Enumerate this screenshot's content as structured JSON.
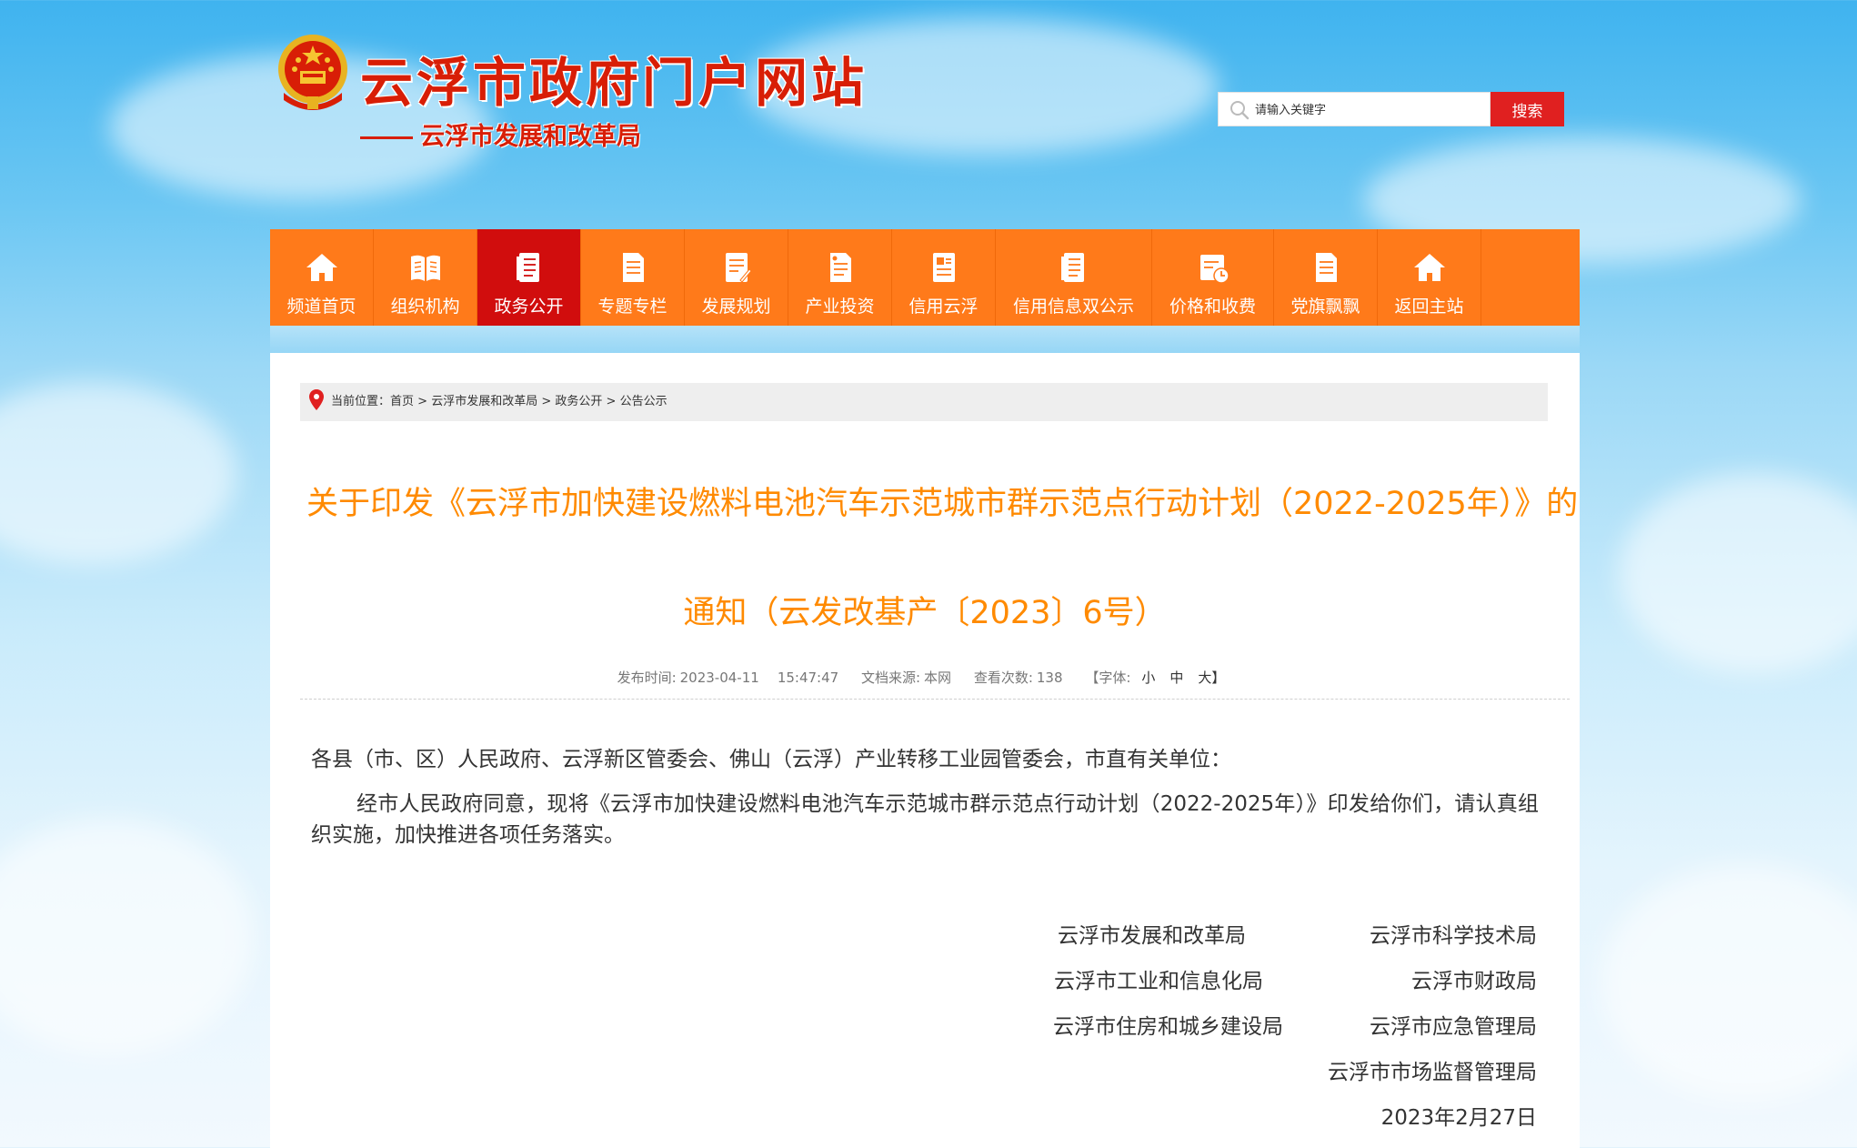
{
  "header": {
    "site_title": "云浮市政府门户网站",
    "sub_title": "云浮市发展和改革局",
    "search": {
      "placeholder": "请输入关键字",
      "button_label": "搜索"
    }
  },
  "nav": {
    "items": [
      {
        "label": "频道首页",
        "icon": "home-icon"
      },
      {
        "label": "组织机构",
        "icon": "book-icon"
      },
      {
        "label": "政务公开",
        "icon": "document-icon",
        "active": true
      },
      {
        "label": "专题专栏",
        "icon": "document-icon"
      },
      {
        "label": "发展规划",
        "icon": "document-edit-icon"
      },
      {
        "label": "产业投资",
        "icon": "document-icon"
      },
      {
        "label": "信用云浮",
        "icon": "document-icon"
      },
      {
        "label": "信用信息双公示",
        "icon": "document-icon"
      },
      {
        "label": "价格和收费",
        "icon": "calendar-clock-icon"
      },
      {
        "label": "党旗飘飘",
        "icon": "document-icon"
      },
      {
        "label": "返回主站",
        "icon": "home-icon"
      }
    ],
    "active_color": "#d10d0d",
    "bar_color": "#ff7a1a"
  },
  "breadcrumb": {
    "prefix": "当前位置：",
    "items": [
      "首页",
      "云浮市发展和改革局",
      "政务公开",
      "公告公示"
    ],
    "separator": " > "
  },
  "article": {
    "title_line1": "关于印发《云浮市加快建设燃料电池汽车示范城市群示范点行动计划（2022-2025年）》的",
    "title_line2": "通知（云发改基产〔2023〕6号）",
    "meta": {
      "publish_label": "发布时间:",
      "publish_date": "2023-04-11",
      "publish_time": "15:47:47",
      "source_label": "文档来源:",
      "source": "本网",
      "views_label": "查看次数:",
      "views": "138",
      "font_label": "【字体:",
      "font_small": "小",
      "font_medium": "中",
      "font_large": "大】"
    },
    "addressee": "各县（市、区）人民政府、云浮新区管委会、佛山（云浮）产业转移工业园管委会，市直有关单位：",
    "paragraph": "经市人民政府同意，现将《云浮市加快建设燃料电池汽车示范城市群示范点行动计划（2022-2025年）》印发给你们，请认真组织实施，加快推进各项任务落实。",
    "signatures": {
      "left": [
        "云浮市发展和改革局",
        "云浮市工业和信息化局",
        "云浮市住房和城乡建设局"
      ],
      "right": [
        "云浮市科学技术局",
        "云浮市财政局",
        "云浮市应急管理局",
        "云浮市市场监督管理局"
      ],
      "date": "2023年2月27日"
    },
    "title_color": "#ff8a00"
  }
}
